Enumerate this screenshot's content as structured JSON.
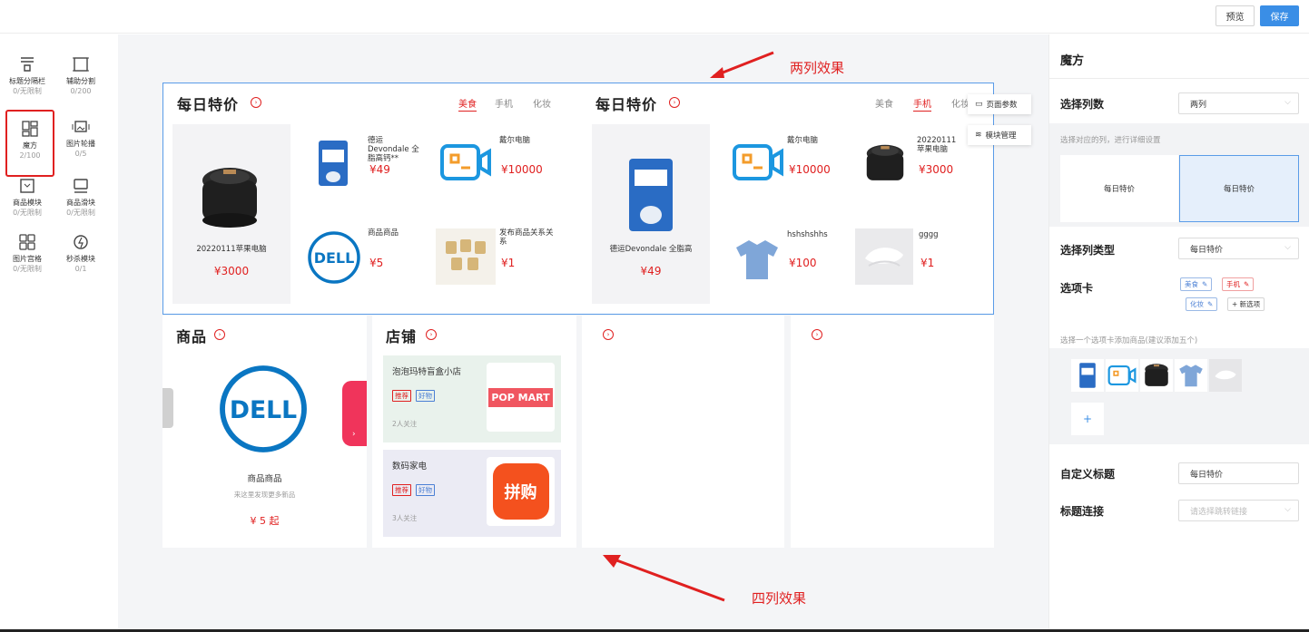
{
  "topbar": {
    "preview_label": "预览",
    "save_label": "保存"
  },
  "components": [
    {
      "name": "标题分隔栏",
      "count": "0/无限制",
      "icon": "title-divider-icon"
    },
    {
      "name": "辅助分割",
      "count": "0/200",
      "icon": "aux-divider-icon"
    },
    {
      "name": "魔方",
      "count": "2/100",
      "icon": "magic-cube-icon"
    },
    {
      "name": "图片轮播",
      "count": "0/5",
      "icon": "image-carousel-icon"
    },
    {
      "name": "商品模块",
      "count": "0/无限制",
      "icon": "product-module-icon"
    },
    {
      "name": "商品滑块",
      "count": "0/无限制",
      "icon": "product-slider-icon"
    },
    {
      "name": "图片宫格",
      "count": "0/无限制",
      "icon": "image-grid-icon"
    },
    {
      "name": "秒杀模块",
      "count": "0/1",
      "icon": "flash-sale-icon"
    }
  ],
  "canvas": {
    "block1": {
      "title": "每日特价",
      "tabs": [
        "美食",
        "手机",
        "化妆"
      ],
      "hero": {
        "name": "20220111苹果电脑",
        "price": "¥3000"
      },
      "items": [
        {
          "name": "德运Devondale 全脂高钙**",
          "price": "¥49"
        },
        {
          "name": "戴尔电脑",
          "price": "¥10000"
        },
        {
          "name": "商品商品",
          "price": "¥5"
        },
        {
          "name": "发布商品关系关系",
          "price": "¥1"
        }
      ]
    },
    "block2": {
      "title": "每日特价",
      "tabs": [
        "美食",
        "手机",
        "化妆"
      ],
      "hero": {
        "name": "德运Devondale 全脂高",
        "price": "¥49"
      },
      "items": [
        {
          "name": "戴尔电脑",
          "price": "¥10000"
        },
        {
          "name": "20220111苹果电脑",
          "price": "¥3000"
        },
        {
          "name": "hshshshhs",
          "price": "¥100"
        },
        {
          "name": "gggg",
          "price": "¥1"
        }
      ]
    },
    "float_menu": {
      "page_params": "页面参数",
      "module_manage": "模块管理"
    },
    "products": {
      "title": "商品",
      "item_name": "商品商品",
      "item_desc": "来这里发现更多新品",
      "item_price": "¥ 5 起"
    },
    "stores": {
      "title": "店铺",
      "list": [
        {
          "name": "泡泡玛特盲盒小店",
          "tags": [
            "推荐",
            "好物"
          ],
          "follow": "2人关注",
          "logo": "POP MART"
        },
        {
          "name": "数码家电",
          "tags": [
            "推荐",
            "好物"
          ],
          "follow": "3人关注",
          "logo": "拼购"
        }
      ]
    },
    "annotations": {
      "two_col": "两列效果",
      "four_col": "四列效果"
    }
  },
  "rightpanel": {
    "title": "魔方",
    "col_count_label": "选择列数",
    "col_count_value": "两列",
    "col_hint": "选择对应的列，进行详细设置",
    "columns": [
      "每日特价",
      "每日特价"
    ],
    "col_type_label": "选择列类型",
    "col_type_value": "每日特价",
    "tabs_label": "选项卡",
    "tab_tags": [
      "美食",
      "手机",
      "化妆"
    ],
    "add_tab": "+ 新选项",
    "tab_hint": "选择一个选项卡添加商品(建议添加五个)",
    "add_product": "+",
    "custom_title_label": "自定义标题",
    "custom_title_value": "每日特价",
    "title_link_label": "标题连接",
    "title_link_placeholder": "请选择跳转链接"
  },
  "colors": {
    "accent": "#e02020",
    "primary": "#3a8ee6"
  }
}
